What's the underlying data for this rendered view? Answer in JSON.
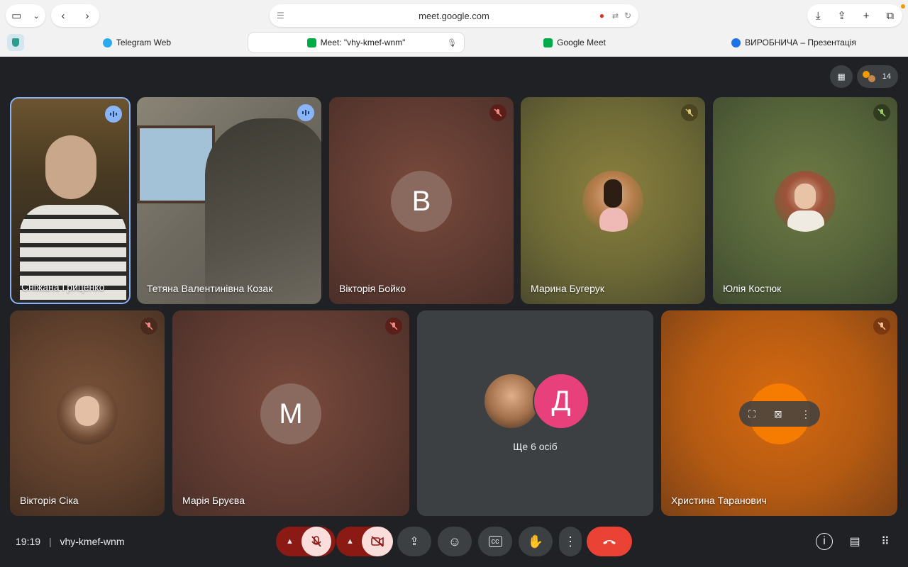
{
  "browser": {
    "url": "meet.google.com",
    "tabs": [
      {
        "label": "Telegram Web",
        "favicon_color": "#2aabee"
      },
      {
        "label": "Meet: \"vhy-kmef-wnm\"",
        "favicon_color": "#00ac47"
      },
      {
        "label": "Google Meet",
        "favicon_color": "#00ac47"
      },
      {
        "label": "ВИРОБНИЧА – Презентація",
        "favicon_color": "#1a73e8"
      }
    ]
  },
  "header": {
    "participant_count": "14"
  },
  "tiles": [
    {
      "name": "Сніжана Гриценко",
      "status": "speaking"
    },
    {
      "name": "Тетяна Валентинівна Козак",
      "status": "speaking"
    },
    {
      "name": "Вікторія Бойко",
      "status": "muted",
      "avatar_letter": "В"
    },
    {
      "name": "Марина Бугерук",
      "status": "muted"
    },
    {
      "name": "Юлія Костюк",
      "status": "muted"
    },
    {
      "name": "Вікторія Сіка",
      "status": "muted"
    },
    {
      "name": "Марія Бруєва",
      "status": "muted",
      "avatar_letter": "М"
    },
    {
      "name": "Ще 6 осіб",
      "avatar_letter": "Д"
    },
    {
      "name": "Христина Таранович",
      "status": "muted"
    }
  ],
  "footer": {
    "time": "19:19",
    "separator": "|",
    "meeting_code": "vhy-kmef-wnm"
  },
  "colors": {
    "accent_blue": "#8ab4f8",
    "end_call": "#ea4335",
    "mic_off_bg": "#f9dedc"
  }
}
